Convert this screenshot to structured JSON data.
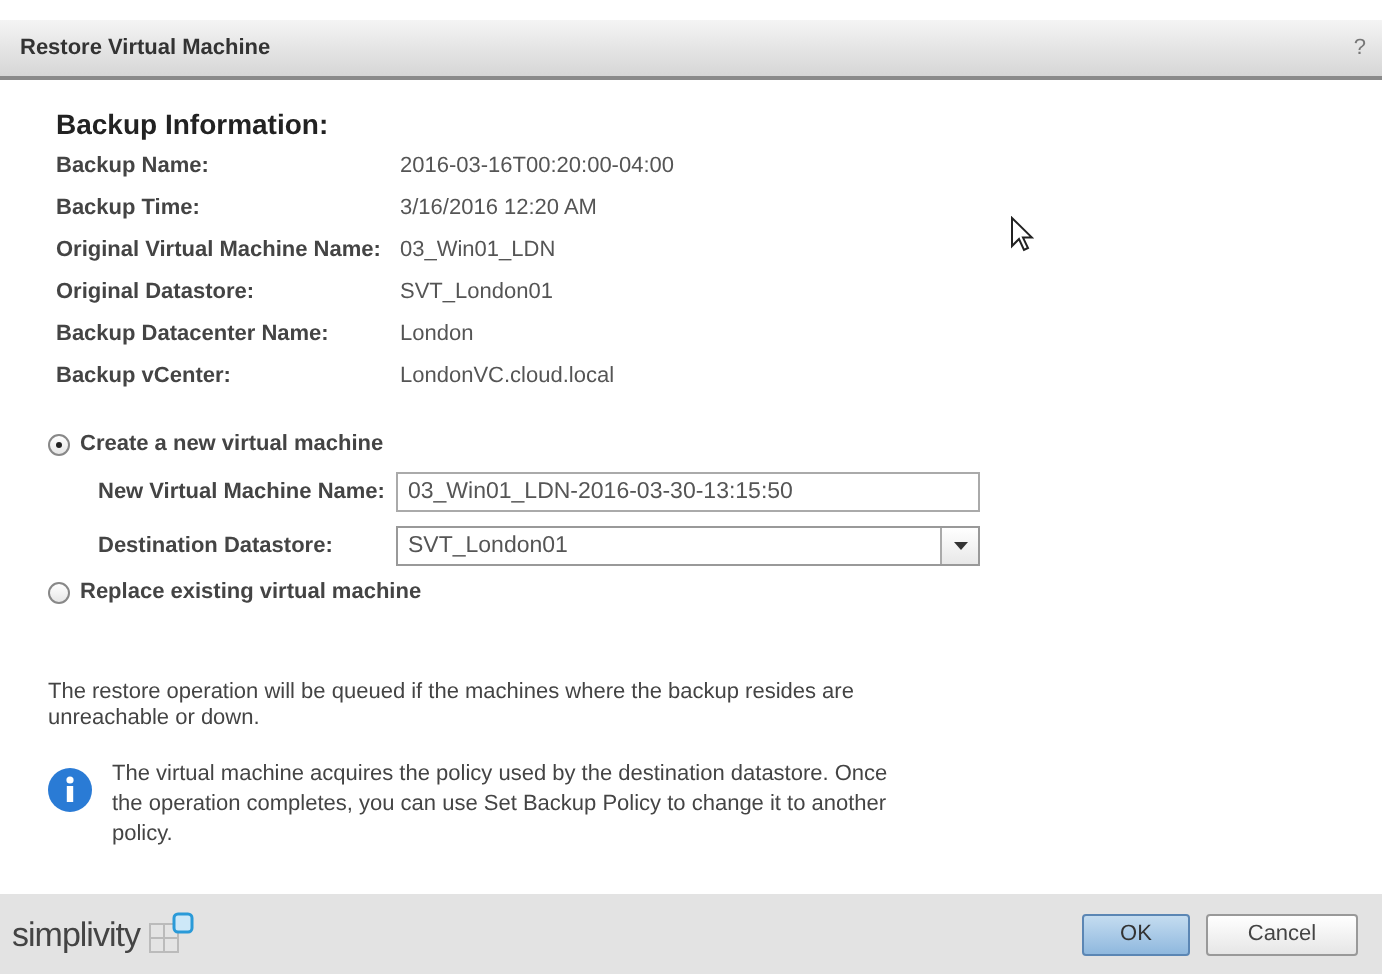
{
  "window": {
    "title": "Restore Virtual Machine",
    "help": "?"
  },
  "backup_info": {
    "heading": "Backup Information:",
    "rows": [
      {
        "label": "Backup Name:",
        "value": "2016-03-16T00:20:00-04:00"
      },
      {
        "label": "Backup Time:",
        "value": "3/16/2016 12:20 AM"
      },
      {
        "label": "Original Virtual Machine Name:",
        "value": "03_Win01_LDN"
      },
      {
        "label": "Original Datastore:",
        "value": "SVT_London01"
      },
      {
        "label": "Backup Datacenter Name:",
        "value": "London"
      },
      {
        "label": "Backup vCenter:",
        "value": "LondonVC.cloud.local"
      }
    ]
  },
  "options": [
    {
      "label": "Create a new virtual machine",
      "selected": true,
      "fields": [
        {
          "kind": "text",
          "label": "New Virtual Machine Name:",
          "value": "03_Win01_LDN-2016-03-30-13:15:50"
        },
        {
          "kind": "dropdown",
          "label": "Destination Datastore:",
          "value": "SVT_London01"
        }
      ]
    },
    {
      "label": "Replace existing virtual machine",
      "selected": false
    }
  ],
  "note": "The restore operation will be queued if the machines where the backup resides are unreachable or down.",
  "info": "The virtual machine acquires the policy used by the destination datastore. Once the operation completes, you can use Set Backup Policy to change it to another policy.",
  "footer": {
    "logo": "simplivity",
    "buttons": [
      {
        "label": "OK",
        "primary": true
      },
      {
        "label": "Cancel",
        "primary": false
      }
    ]
  }
}
